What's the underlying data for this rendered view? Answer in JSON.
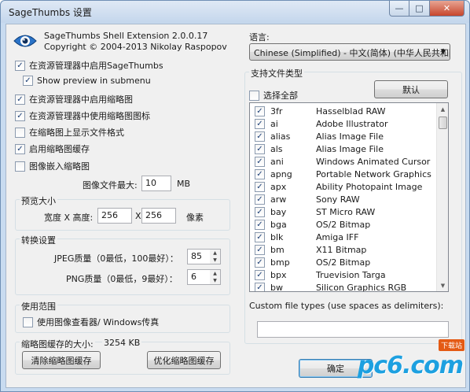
{
  "window": {
    "title": "SageThumbs 设置",
    "min": "—",
    "max": "□",
    "close": "✕"
  },
  "header": {
    "product": "SageThumbs Shell Extension 2.0.0.17",
    "copyright": "Copyright © 2004-2013 Nikolay Raspopov"
  },
  "options": [
    {
      "label": "在资源管理器中启用SageThumbs",
      "checked": true
    },
    {
      "label": "Show preview in submenu",
      "checked": true
    },
    {
      "label": "在资源管理器中启用缩略图",
      "checked": true
    },
    {
      "label": "在资源管理器中使用缩略图图标",
      "checked": true
    },
    {
      "label": "在缩略图上显示文件格式",
      "checked": false
    },
    {
      "label": "启用缩略图缓存",
      "checked": true
    },
    {
      "label": "图像嵌入缩略图",
      "checked": false
    }
  ],
  "max_file": {
    "label": "图像文件最大:",
    "value": "10",
    "unit": "MB"
  },
  "preview": {
    "title": "预览大小",
    "label": "宽度 X 高度:",
    "width": "256",
    "sep": "X",
    "height": "256",
    "unit": "像素"
  },
  "convert": {
    "title": "转换设置",
    "jpeg_label": "JPEG质量（0最低，100最好）：",
    "jpeg_value": "85",
    "png_label": "PNG质量（0最低，9最好）：",
    "png_value": "6"
  },
  "scope": {
    "title": "使用范围",
    "viewer_label": "使用图像查看器/ Windows传真",
    "viewer_checked": false
  },
  "cache": {
    "label": "缩略图缓存的大小:",
    "size": "3254 KB",
    "clear": "清除缩略图缓存",
    "optimize": "优化缩略图缓存"
  },
  "language": {
    "label": "语言:",
    "value": "Chinese (Simplified) - 中文(简体) (中华人民共和国"
  },
  "filetypes": {
    "title": "支持文件类型",
    "select_all": "选择全部",
    "select_all_checked": false,
    "default": "默认",
    "items": [
      {
        "ext": "3fr",
        "desc": "Hasselblad RAW"
      },
      {
        "ext": "ai",
        "desc": "Adobe Illustrator"
      },
      {
        "ext": "alias",
        "desc": "Alias Image File"
      },
      {
        "ext": "als",
        "desc": "Alias Image File"
      },
      {
        "ext": "ani",
        "desc": "Windows Animated Cursor"
      },
      {
        "ext": "apng",
        "desc": "Portable Network Graphics"
      },
      {
        "ext": "apx",
        "desc": "Ability Photopaint Image"
      },
      {
        "ext": "arw",
        "desc": "Sony RAW"
      },
      {
        "ext": "bay",
        "desc": "ST Micro RAW"
      },
      {
        "ext": "bga",
        "desc": "OS/2 Bitmap"
      },
      {
        "ext": "blk",
        "desc": "Amiga IFF"
      },
      {
        "ext": "bm",
        "desc": "X11 Bitmap"
      },
      {
        "ext": "bmp",
        "desc": "OS/2 Bitmap"
      },
      {
        "ext": "bpx",
        "desc": "Truevision Targa"
      },
      {
        "ext": "bw",
        "desc": "Silicon Graphics RGB"
      }
    ],
    "custom_label": "Custom file types (use spaces as delimiters):",
    "custom_value": ""
  },
  "buttons": {
    "ok": "确定"
  },
  "watermark": {
    "text": "pc6.com",
    "badge": "下载站"
  },
  "icons": {
    "logo": "eye-icon",
    "dropdown": "chevron-down-icon",
    "scroll_up": "arrow-up-icon",
    "scroll_down": "arrow-down-icon"
  },
  "colors": {
    "accent": "#3c7fb1",
    "title_bg": "#c4d6ec",
    "logo_blue": "#1da0e0"
  }
}
